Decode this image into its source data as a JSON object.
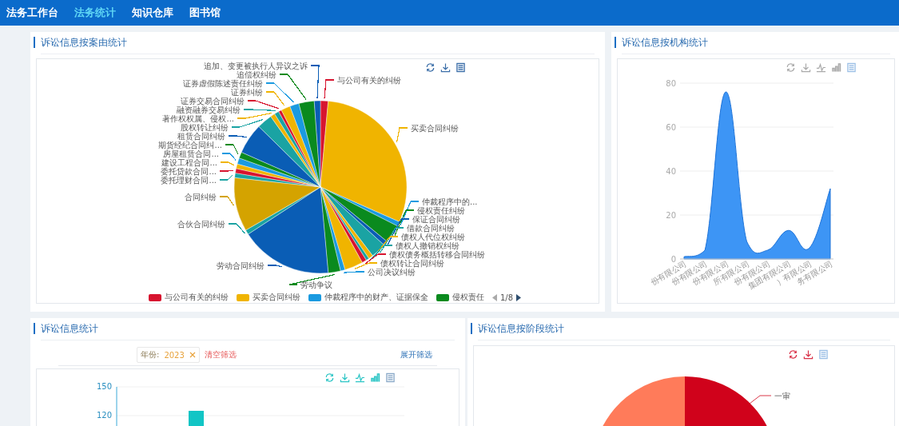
{
  "nav": {
    "items": [
      {
        "label": "法务工作台",
        "selected": false
      },
      {
        "label": "法务统计",
        "selected": true
      },
      {
        "label": "知识仓库",
        "selected": false
      },
      {
        "label": "图书馆",
        "selected": false
      }
    ]
  },
  "cause_panel": {
    "title": "诉讼信息按案由统计",
    "right_labels": [
      {
        "text": "与公司有关的纠纷",
        "color": "#d7142f"
      },
      {
        "text": "买卖合同纠纷",
        "color": "#f0b400"
      },
      {
        "text": "仲裁程序中的...",
        "color": "#1a9ae0"
      },
      {
        "text": "侵权责任纠纷",
        "color": "#0a8a1e"
      },
      {
        "text": "保证合同纠纷",
        "color": "#0a5db5"
      },
      {
        "text": "借款合同纠纷",
        "color": "#1aa3a3"
      },
      {
        "text": "债权人代位权纠纷",
        "color": "#f0b400"
      },
      {
        "text": "债权人撤销权纠纷",
        "color": "#1aa3a3"
      },
      {
        "text": "债权债务概括转移合同纠纷",
        "color": "#d7142f"
      },
      {
        "text": "债权转让合同纠纷",
        "color": "#f0b400"
      },
      {
        "text": "公司决议纠纷",
        "color": "#1a9ae0"
      },
      {
        "text": "劳动争议",
        "color": "#0a8a1e"
      }
    ],
    "left_labels": [
      {
        "text": "追加、变更被执行人异议之诉",
        "color": "#0a5db5"
      },
      {
        "text": "追偿权纠纷",
        "color": "#0a8a1e"
      },
      {
        "text": "证券虚假陈述责任纠纷",
        "color": "#1a9ae0"
      },
      {
        "text": "证券纠纷",
        "color": "#f0b400"
      },
      {
        "text": "证券交易合同纠纷",
        "color": "#d7142f"
      },
      {
        "text": "融资融券交易纠纷",
        "color": "#1aa3a3"
      },
      {
        "text": "著作权权属、侵权...",
        "color": "#f0b400"
      },
      {
        "text": "股权转让纠纷",
        "color": "#1aa3a3"
      },
      {
        "text": "租赁合同纠纷",
        "color": "#0a5db5"
      },
      {
        "text": "期货经纪合同纠...",
        "color": "#0a8a1e"
      },
      {
        "text": "房屋租赁合同...",
        "color": "#1a9ae0"
      },
      {
        "text": "建设工程合同...",
        "color": "#f0b400"
      },
      {
        "text": "委托贷款合同...",
        "color": "#d7142f"
      },
      {
        "text": "委托理财合同...",
        "color": "#1aa3a3"
      },
      {
        "text": "合同纠纷",
        "color": "#d4a300"
      },
      {
        "text": "合伙合同纠纷",
        "color": "#1aa3a3"
      },
      {
        "text": "劳动合同纠纷",
        "color": "#0a5db5"
      }
    ],
    "legend": {
      "items": [
        {
          "label": "与公司有关的纠纷",
          "color": "#d7142f"
        },
        {
          "label": "买卖合同纠纷",
          "color": "#f0b400"
        },
        {
          "label": "仲裁程序中的财产、证据保全",
          "color": "#1a9ae0"
        },
        {
          "label": "侵权责任",
          "color": "#0a8a1e"
        }
      ],
      "page": "1/8"
    }
  },
  "agency_panel": {
    "title": "诉讼信息按机构统计",
    "chart_data": {
      "type": "area",
      "categories": [
        "份有限公司",
        "份有限公司",
        "份有限公司",
        "所有限公司",
        "份有限公司",
        "集团有限公司",
        "）有限公司",
        "务有限公司"
      ],
      "values": [
        1,
        4,
        76,
        8,
        4,
        13,
        5,
        32
      ],
      "grid": true,
      "ylim": [
        0,
        80
      ],
      "yticks": [
        0,
        20,
        40,
        60,
        80
      ]
    }
  },
  "stats_panel": {
    "title": "诉讼信息统计",
    "filter": {
      "tag_label": "年份:",
      "tag_value": "2023",
      "clear": "清空筛选",
      "expand": "展开筛选"
    },
    "chart_data": {
      "type": "bar",
      "values": [
        125
      ],
      "ylim": [
        0,
        150
      ],
      "yticks": [
        120,
        150
      ]
    }
  },
  "stage_panel": {
    "title": "诉讼信息按阶段统计",
    "slices": [
      {
        "label": "一审",
        "color": "#d0021b"
      },
      {
        "color": "#ff7b5a"
      }
    ]
  }
}
